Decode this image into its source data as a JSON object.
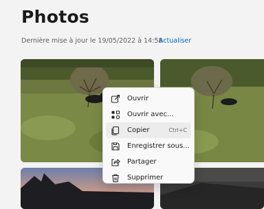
{
  "header": {
    "title": "Photos",
    "last_update": "Dernière mise à jour le 19/05/2022 à 14:58",
    "refresh_label": "Actualiser"
  },
  "context_menu": {
    "items": [
      {
        "label": "Ouvrir",
        "icon": "open-icon",
        "shortcut": ""
      },
      {
        "label": "Ouvrir avec...",
        "icon": "open-with-icon",
        "shortcut": ""
      },
      {
        "label": "Copier",
        "icon": "copy-icon",
        "shortcut": "Ctrl+C"
      },
      {
        "label": "Enregistrer sous...",
        "icon": "save-icon",
        "shortcut": ""
      },
      {
        "label": "Partager",
        "icon": "share-icon",
        "shortcut": ""
      },
      {
        "label": "Supprimer",
        "icon": "delete-icon",
        "shortcut": ""
      }
    ],
    "highlighted": "Copier"
  },
  "colors": {
    "accent": "#0067c0",
    "background": "#f3f3f3"
  }
}
